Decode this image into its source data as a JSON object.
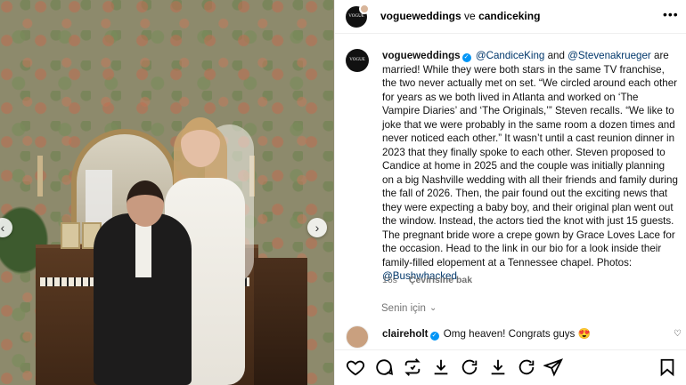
{
  "header": {
    "account_primary": "vogueweddings",
    "connector": "ve",
    "account_secondary": "candiceking",
    "avatar_text": "VOGUE"
  },
  "caption": {
    "username": "vogueweddings",
    "mention_1": "@CandiceKing",
    "and_text": " and ",
    "mention_2": "@Stevenakrueger",
    "body": " are married! While they were both stars in the same TV franchise, the two never actually met on set. “We circled around each other for years as we both lived in Atlanta and worked on ‘The Vampire Diaries’ and ‘The Originals,’” Steven recalls. “We like to joke that we were probably in the same room a dozen times and never noticed each other.” It wasn’t until a cast reunion dinner in 2023 that they finally spoke to each other. Steven proposed to Candice at home in 2025 and the couple was initially planning on a big Nashville wedding with all their friends and family during the fall of 2026. Then, the pair found out the exciting news that they were expecting a baby boy, and their original plan went out the window. Instead, the actors tied the knot with just 15 guests. The pregnant bride wore a crepe gown by Grace Loves Lace for the occasion. Head to the link in our bio for a look inside their family-filled elopement at a Tennessee chapel. Photos: ",
    "photo_credit": "@Bushwhacked",
    "time_ago": "16s",
    "translate_label": "Çevirisine bak"
  },
  "for_you_label": "Senin için",
  "comment": {
    "username": "claireholt",
    "text": "Omg heaven! Congrats guys",
    "emoji": "😍"
  },
  "icons": [
    "heart-icon",
    "comment-icon",
    "repost-icon",
    "share-icon",
    "bookmark-icon"
  ],
  "colors": {
    "mention": "#00376b",
    "verified": "#0095f6",
    "muted": "#737373"
  }
}
